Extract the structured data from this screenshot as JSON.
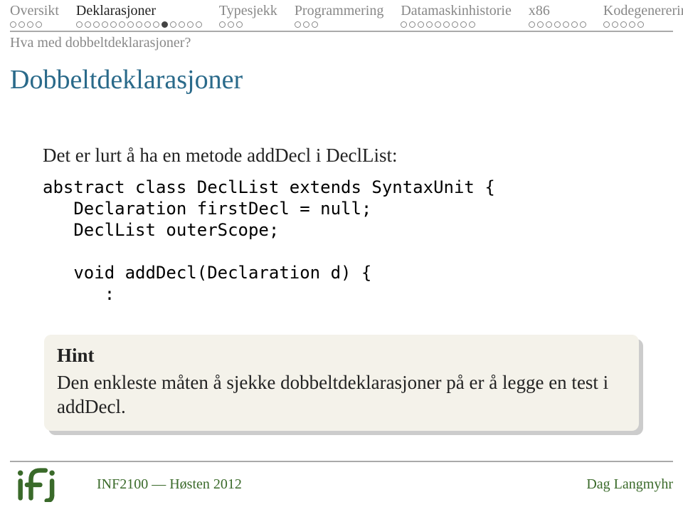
{
  "nav": {
    "items": [
      {
        "label": "Oversikt",
        "dots": 4,
        "current": -1,
        "active": false
      },
      {
        "label": "Deklarasjoner",
        "dots": 15,
        "current": 10,
        "active": true
      },
      {
        "label": "Typesjekk",
        "dots": 3,
        "current": -1,
        "active": false
      },
      {
        "label": "Programmering",
        "dots": 3,
        "current": -1,
        "active": false
      },
      {
        "label": "Datamaskinhistorie",
        "dots": 9,
        "current": -1,
        "active": false
      },
      {
        "label": "x86",
        "dots": 7,
        "current": -1,
        "active": false
      },
      {
        "label": "Kodegenerering",
        "dots": 5,
        "current": -1,
        "active": false
      }
    ]
  },
  "subsection": "Hva med dobbeltdeklarasjoner?",
  "title": "Dobbeltdeklarasjoner",
  "lead": "Det er lurt å ha en metode addDecl i DeclList:",
  "code": "abstract class DeclList extends SyntaxUnit {\n   Declaration firstDecl = null;\n   DeclList outerScope;\n\n   void addDecl(Declaration d) {\n      :",
  "hint": {
    "title": "Hint",
    "text": "Den enkleste måten å sjekke dobbeltdeklarasjoner på er å legge en test i addDecl."
  },
  "footer": {
    "course": "INF2100 — Høsten 2012",
    "author": "Dag Langmyhr"
  }
}
